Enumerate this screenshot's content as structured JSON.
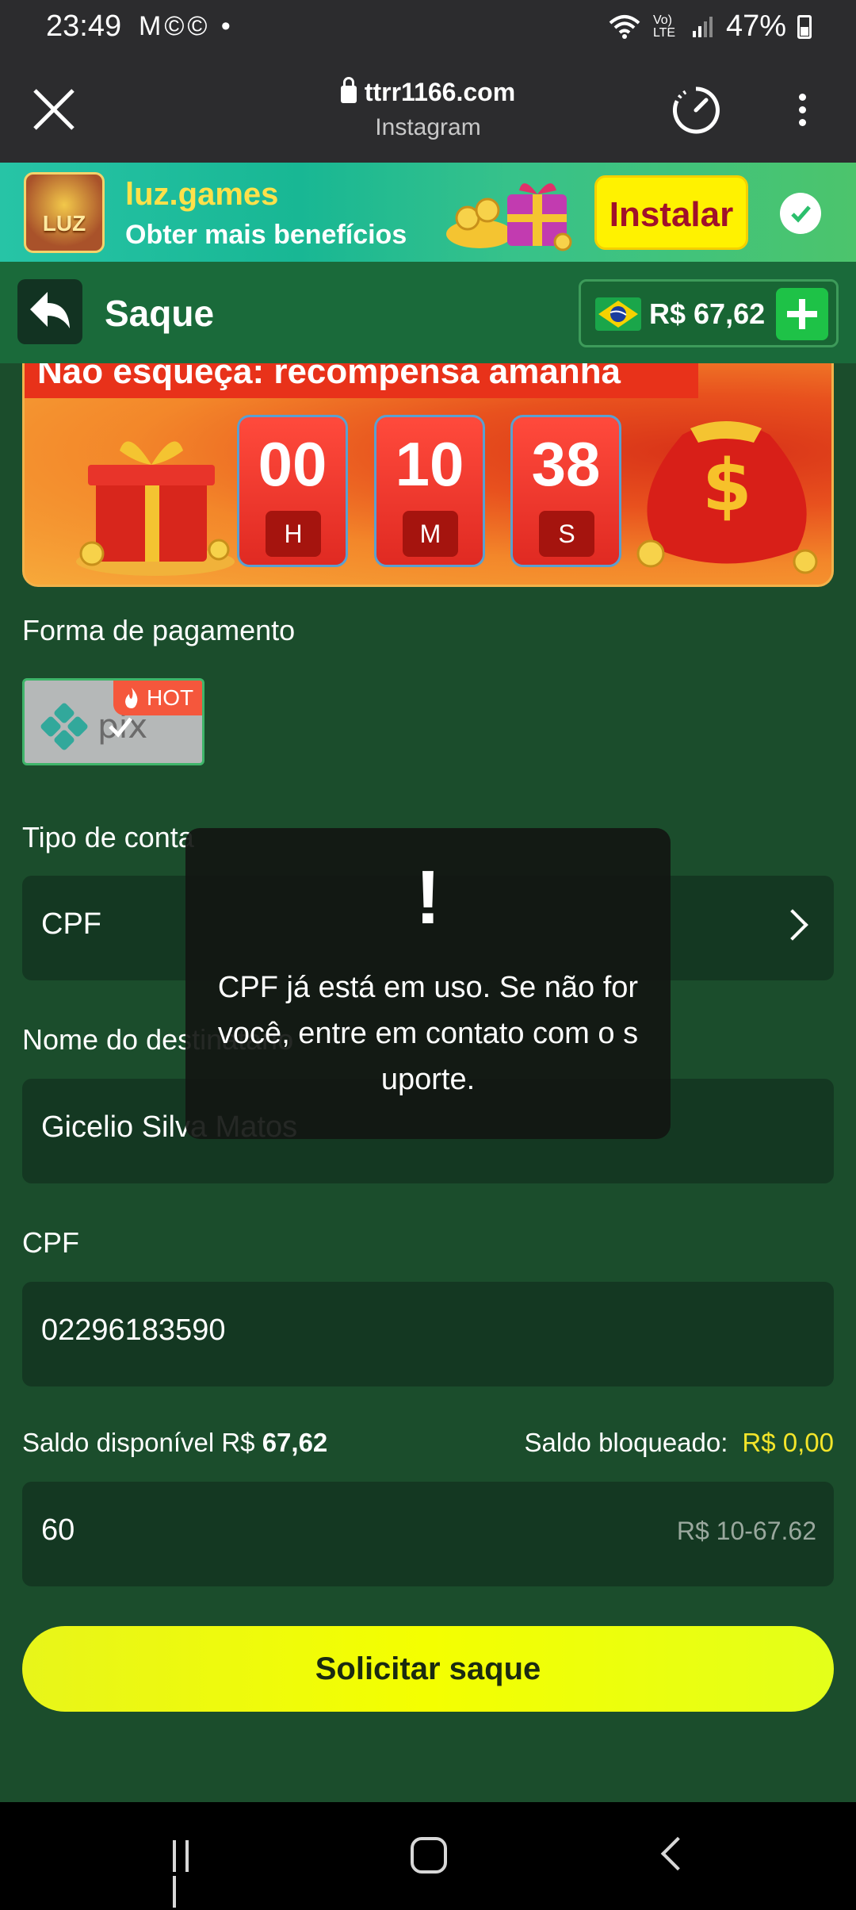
{
  "status_bar": {
    "time": "23:49",
    "left_icons": "M©© •",
    "signal": "Vo) LTE",
    "battery": "47%"
  },
  "browser": {
    "url": "ttrr1166.com",
    "source": "Instagram"
  },
  "app_banner": {
    "logo_text": "LUZ",
    "name": "luz.games",
    "subtitle": "Obter mais benefícios",
    "install_label": "Instalar"
  },
  "header": {
    "title": "Saque",
    "balance": "R$ 67,62"
  },
  "promo": {
    "title": "Não esqueça: recompensa amanhã",
    "timer": [
      {
        "value": "00",
        "unit": "H"
      },
      {
        "value": "10",
        "unit": "M"
      },
      {
        "value": "38",
        "unit": "S"
      }
    ]
  },
  "form": {
    "payment_label": "Forma de pagamento",
    "pix_hot": "HOT",
    "account_type_label": "Tipo de conta",
    "account_type_value": "CPF",
    "recipient_label": "Nome do destinatário",
    "recipient_value": "Gicelio Silva Matos",
    "cpf_label": "CPF",
    "cpf_value": "02296183590",
    "saldo_disponivel_label": "Saldo disponível R$",
    "saldo_disponivel_value": "67,62",
    "saldo_bloqueado_label": "Saldo bloqueado:",
    "saldo_bloqueado_value": "R$ 0,00",
    "amount_value": "60",
    "amount_hint": "R$ 10-67.62",
    "submit_label": "Solicitar saque"
  },
  "toast": {
    "icon": "!",
    "message": "CPF já está em uso. Se não for você, entre em contato com o suporte."
  },
  "colors": {
    "background": "#1b4d2c",
    "header": "#1a6a3a",
    "submit": "#f4ff00",
    "accent_yellow": "#f3e52a"
  }
}
